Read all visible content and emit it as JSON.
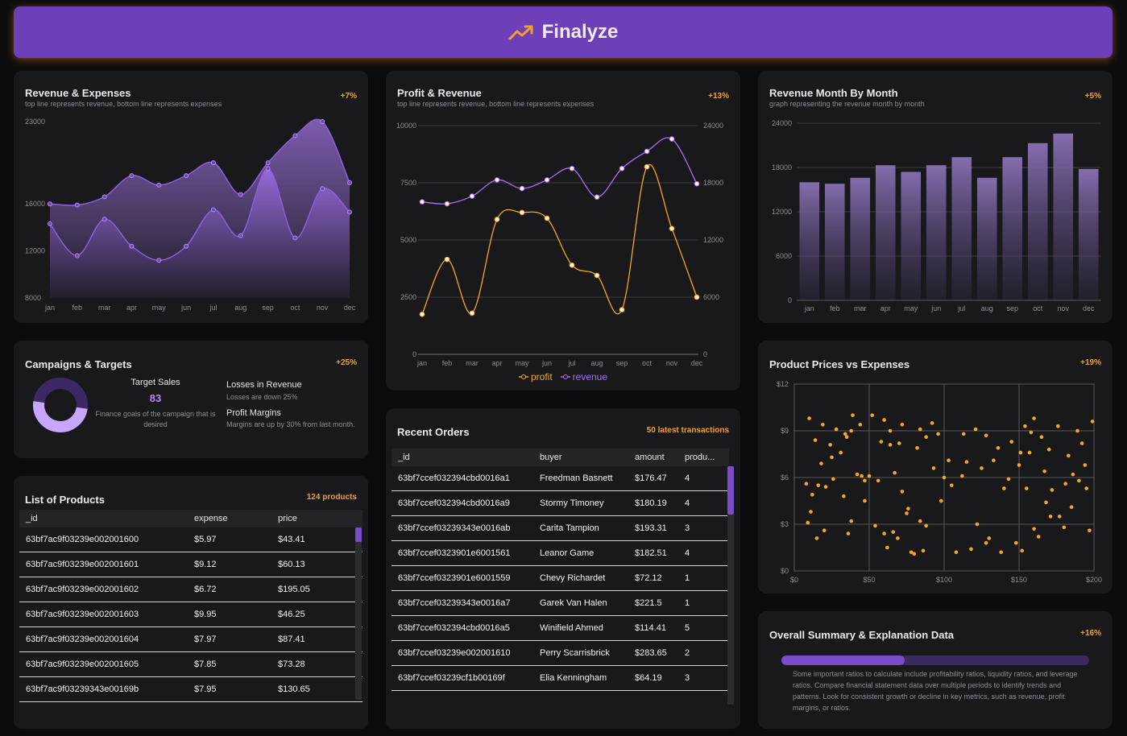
{
  "app": {
    "title": "Finalyze"
  },
  "months": [
    "jan",
    "feb",
    "mar",
    "apr",
    "may",
    "jun",
    "jul",
    "aug",
    "sep",
    "oct",
    "nov",
    "dec"
  ],
  "cards": {
    "rev_exp": {
      "title": "Revenue & Expenses",
      "subtitle": "top line represents revenue, bottom line represents expenses",
      "badge": "+7%"
    },
    "profit_rev": {
      "title": "Profit & Revenue",
      "subtitle": "top line represents revenue, bottom line represents expenses",
      "badge": "+13%",
      "legend_profit": "profit",
      "legend_revenue": "revenue"
    },
    "rev_month": {
      "title": "Revenue Month By Month",
      "subtitle": "graph representing the revenue month by month",
      "badge": "+5%"
    },
    "campaigns": {
      "title": "Campaigns & Targets",
      "badge": "+25%",
      "target_label": "Target Sales",
      "target_value": "83",
      "target_desc": "Finance goals of the campaign that is desired",
      "losses_title": "Losses in Revenue",
      "losses_sub": "Losses are down 25%",
      "margins_title": "Profit Margins",
      "margins_sub": "Margins are up by 30% from last month.",
      "donut_pct": 0.5
    },
    "prices": {
      "title": "Product Prices vs Expenses",
      "badge": "+19%"
    },
    "products": {
      "title": "List of Products",
      "badge": "124 products"
    },
    "orders": {
      "title": "Recent Orders",
      "badge": "50 latest transactions"
    },
    "summary": {
      "title": "Overall Summary & Explanation Data",
      "badge": "+16%",
      "progress": 0.4,
      "text": "Some important ratios to calculate include profitability ratios, liquidity ratios, and leverage ratios. Compare financial statement data over multiple periods to identify trends and patterns. Look for consistent growth or decline in key metrics, such as revenue, profit margins, or ratios."
    }
  },
  "products_table": {
    "columns": [
      "_id",
      "expense",
      "price"
    ],
    "rows": [
      [
        "63bf7ac9f03239e002001600",
        "$5.97",
        "$43.41"
      ],
      [
        "63bf7ac9f03239e002001601",
        "$9.12",
        "$60.13"
      ],
      [
        "63bf7ac9f03239e002001602",
        "$6.72",
        "$195.05"
      ],
      [
        "63bf7ac9f03239e002001603",
        "$9.95",
        "$46.25"
      ],
      [
        "63bf7ac9f03239e002001604",
        "$7.97",
        "$87.41"
      ],
      [
        "63bf7ac9f03239e002001605",
        "$7.85",
        "$73.28"
      ],
      [
        "63bf7ac9f03239343e00169b",
        "$7.95",
        "$130.65"
      ]
    ]
  },
  "orders_table": {
    "columns": [
      "_id",
      "buyer",
      "amount",
      "produ..."
    ],
    "rows": [
      [
        "63bf7ccef032394cbd0016a1",
        "Freedman Basnett",
        "$176.47",
        "4"
      ],
      [
        "63bf7ccef032394cbd0016a9",
        "Stormy Timoney",
        "$180.19",
        "4"
      ],
      [
        "63bf7ccef03239343e0016ab",
        "Carita Tampion",
        "$193.31",
        "3"
      ],
      [
        "63bf7ccef0323901e6001561",
        "Leanor Game",
        "$182.51",
        "4"
      ],
      [
        "63bf7ccef0323901e6001559",
        "Chevy Richardet",
        "$72.12",
        "1"
      ],
      [
        "63bf7ccef03239343e0016a7",
        "Garek Van Halen",
        "$221.5",
        "1"
      ],
      [
        "63bf7ccef032394cbd0016a5",
        "Winifield Ahmed",
        "$114.41",
        "5"
      ],
      [
        "63bf7ccef03239e002001610",
        "Perry Scarrisbrick",
        "$283.65",
        "2"
      ],
      [
        "63bf7ccef03239cf1b00169f",
        "Elia Kenningham",
        "$64.19",
        "3"
      ]
    ]
  },
  "chart_data": [
    {
      "id": "revenue_expenses",
      "type": "area",
      "categories": [
        "jan",
        "feb",
        "mar",
        "apr",
        "may",
        "jun",
        "jul",
        "aug",
        "sep",
        "oct",
        "nov",
        "dec"
      ],
      "ylim": [
        8000,
        23000
      ],
      "yticks": [
        8000,
        12000,
        16000,
        23000
      ],
      "series": [
        {
          "values": [
            16000,
            15900,
            16600,
            18400,
            17600,
            18400,
            19500,
            16800,
            19500,
            21800,
            23000,
            17800
          ]
        },
        {
          "values": [
            14300,
            11600,
            14700,
            12400,
            11200,
            12400,
            15500,
            13300,
            19000,
            13100,
            17300,
            15300
          ]
        }
      ]
    },
    {
      "id": "profit_revenue",
      "type": "line",
      "categories": [
        "jan",
        "feb",
        "mar",
        "apr",
        "may",
        "jun",
        "jul",
        "aug",
        "sep",
        "oct",
        "nov",
        "dec"
      ],
      "ylim_left": [
        0,
        10000
      ],
      "yticks_left": [
        0,
        2500,
        5000,
        7500,
        10000
      ],
      "ylim_right": [
        0,
        24000
      ],
      "yticks_right": [
        0,
        6000,
        12000,
        18000,
        24000
      ],
      "series": [
        {
          "name": "profit",
          "axis": "left",
          "color": "#f5a623",
          "values": [
            1750,
            4150,
            1800,
            5900,
            6200,
            5950,
            3900,
            3450,
            1950,
            8200,
            5500,
            2500
          ]
        },
        {
          "name": "revenue",
          "axis": "right",
          "color": "#a66ff5",
          "values": [
            16000,
            15800,
            16600,
            18300,
            17400,
            18300,
            19500,
            16500,
            19500,
            21300,
            22600,
            17900
          ]
        }
      ]
    },
    {
      "id": "revenue_month",
      "type": "bar",
      "categories": [
        "jan",
        "feb",
        "mar",
        "apr",
        "may",
        "jun",
        "jul",
        "aug",
        "sep",
        "oct",
        "nov",
        "dec"
      ],
      "ylim": [
        0,
        24000
      ],
      "yticks": [
        0,
        6000,
        12000,
        18000,
        24000
      ],
      "values": [
        16000,
        15800,
        16600,
        18300,
        17400,
        18300,
        19400,
        16600,
        19400,
        21300,
        22600,
        17800
      ]
    },
    {
      "id": "prices_expenses",
      "type": "scatter",
      "xlim": [
        0,
        200
      ],
      "ylim": [
        0,
        12
      ],
      "xticks": [
        0,
        50,
        100,
        150,
        200
      ],
      "yticks": [
        0,
        3,
        6,
        9,
        12
      ],
      "xtick_labels": [
        "$0",
        "$50",
        "$100",
        "$150",
        "$200"
      ],
      "ytick_labels": [
        "$0",
        "$3",
        "$6",
        "$9",
        "$12"
      ],
      "points": [
        [
          10,
          9.8
        ],
        [
          14,
          8.4
        ],
        [
          19,
          9.4
        ],
        [
          26,
          5.9
        ],
        [
          31,
          7.6
        ],
        [
          35,
          8.6
        ],
        [
          39,
          10
        ],
        [
          34,
          8.8
        ],
        [
          42,
          6.2
        ],
        [
          47,
          5.8
        ],
        [
          52,
          10
        ],
        [
          58,
          8.3
        ],
        [
          60,
          9.7
        ],
        [
          64,
          8.1
        ],
        [
          67,
          6.3
        ],
        [
          72,
          9.4
        ],
        [
          76,
          4
        ],
        [
          84,
          9.1
        ],
        [
          88,
          8.6
        ],
        [
          93,
          6.6
        ],
        [
          96,
          8.8
        ],
        [
          100,
          6
        ],
        [
          113,
          8.8
        ],
        [
          121,
          9.1
        ],
        [
          128,
          8.7
        ],
        [
          136,
          7.9
        ],
        [
          143,
          5.9
        ],
        [
          150,
          6.8
        ],
        [
          154,
          9.3
        ],
        [
          158,
          8.9
        ],
        [
          165,
          8.6
        ],
        [
          170,
          7.8
        ],
        [
          176,
          9.3
        ],
        [
          181,
          5.6
        ],
        [
          185,
          4.1
        ],
        [
          190,
          5.8
        ],
        [
          194,
          6.8
        ],
        [
          199,
          9.6
        ],
        [
          189,
          9
        ],
        [
          171,
          3.5
        ],
        [
          167,
          6.4
        ],
        [
          160,
          2.7
        ],
        [
          152,
          1.3
        ],
        [
          148,
          1.8
        ],
        [
          138,
          1.2
        ],
        [
          128,
          1.8
        ],
        [
          118,
          1.4
        ],
        [
          108,
          1.2
        ],
        [
          86,
          1.3
        ],
        [
          80,
          1.1
        ],
        [
          78,
          1.2
        ],
        [
          69,
          2.1
        ],
        [
          62,
          1.5
        ],
        [
          60,
          2.4
        ],
        [
          54,
          2.9
        ],
        [
          50,
          6.1
        ],
        [
          47,
          4.5
        ],
        [
          38,
          3.2
        ],
        [
          36,
          2.4
        ],
        [
          20,
          2.6
        ],
        [
          9,
          3.1
        ],
        [
          15,
          2.1
        ],
        [
          8,
          5.6
        ],
        [
          12,
          4.9
        ],
        [
          21,
          5.4
        ],
        [
          33,
          4.8
        ],
        [
          45,
          6.1
        ],
        [
          70,
          8.2
        ],
        [
          82,
          7.9
        ],
        [
          98,
          4.5
        ],
        [
          115,
          7
        ],
        [
          125,
          6.6
        ],
        [
          133,
          7.1
        ],
        [
          140,
          5.3
        ],
        [
          157,
          7.6
        ],
        [
          163,
          2.2
        ],
        [
          172,
          5.2
        ],
        [
          177,
          3.5
        ],
        [
          183,
          7.4
        ],
        [
          195,
          5.3
        ],
        [
          197,
          2.6
        ],
        [
          180,
          2.8
        ],
        [
          155,
          5.3
        ],
        [
          145,
          8.3
        ],
        [
          112,
          6.1
        ],
        [
          103,
          7.1
        ],
        [
          88,
          2.9
        ],
        [
          75,
          3.7
        ],
        [
          66,
          2.5
        ],
        [
          56,
          5.8
        ],
        [
          44,
          9.4
        ],
        [
          24,
          8.1
        ],
        [
          16,
          5.5
        ],
        [
          28,
          9.1
        ],
        [
          130,
          2.1
        ],
        [
          160,
          9.8
        ],
        [
          186,
          6.2
        ],
        [
          192,
          8.2
        ],
        [
          151,
          7.6
        ],
        [
          168,
          4.4
        ],
        [
          122,
          3
        ],
        [
          105,
          5.5
        ],
        [
          92,
          9.5
        ],
        [
          84,
          3.2
        ],
        [
          72,
          5.1
        ],
        [
          64,
          9
        ],
        [
          38,
          9
        ],
        [
          25,
          7.3
        ],
        [
          18,
          6.9
        ],
        [
          11,
          3.8
        ]
      ]
    }
  ]
}
